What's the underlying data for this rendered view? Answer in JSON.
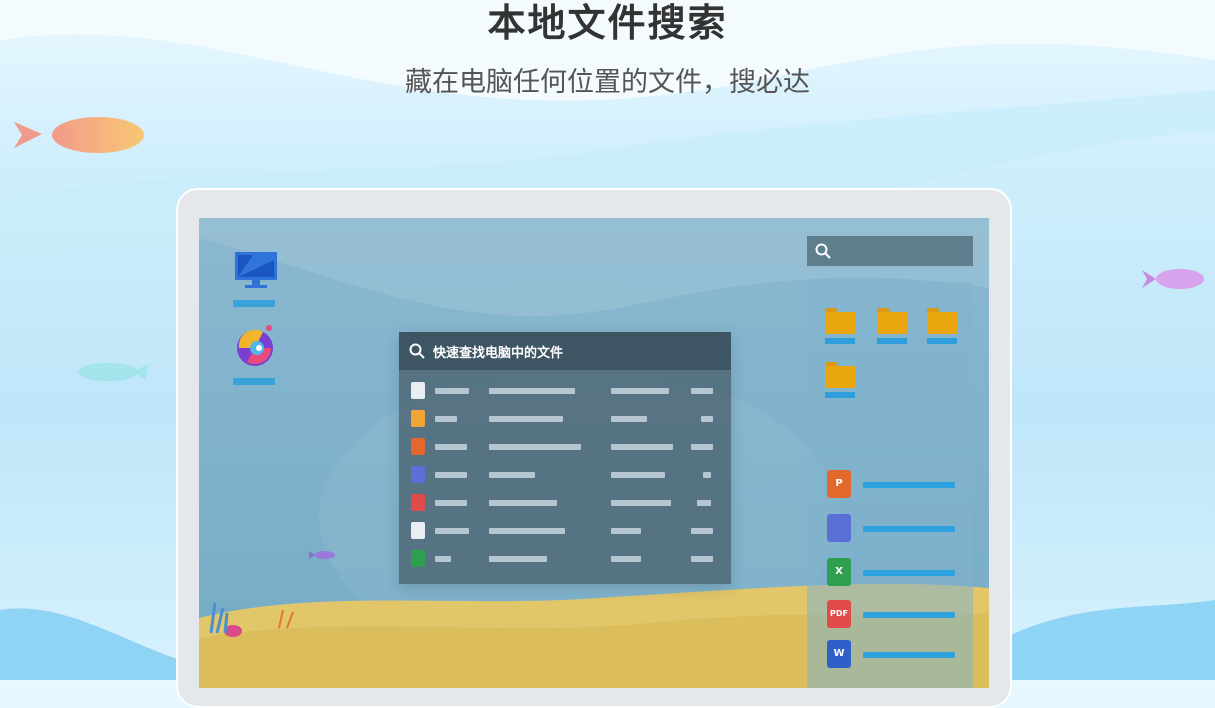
{
  "header": {
    "title": "本地文件搜索",
    "subtitle": "藏在电脑任何位置的文件，搜必达"
  },
  "search_window": {
    "title": "快速查找电脑中的文件",
    "rows": [
      {
        "icon": "document-icon",
        "color": "#e8eef2"
      },
      {
        "icon": "folder-icon",
        "color": "#f0a536"
      },
      {
        "icon": "powerpoint-icon",
        "color": "#e2692b"
      },
      {
        "icon": "image-icon",
        "color": "#5b6fd6"
      },
      {
        "icon": "pdf-icon",
        "color": "#e24b4b"
      },
      {
        "icon": "document-icon",
        "color": "#e8eef2"
      },
      {
        "icon": "excel-icon",
        "color": "#2e9e4f"
      }
    ]
  },
  "right_apps": [
    {
      "icon": "powerpoint-icon",
      "letter": "P",
      "color": "#e2692b"
    },
    {
      "icon": "image-icon",
      "letter": "",
      "color": "#5b6fd6"
    },
    {
      "icon": "excel-icon",
      "letter": "X",
      "color": "#2e9e4f"
    },
    {
      "icon": "pdf-icon",
      "letter": "PDF",
      "color": "#e24b4b"
    },
    {
      "icon": "word-icon",
      "letter": "W",
      "color": "#2f5fc9"
    }
  ],
  "colors": {
    "accent": "#2ea2de",
    "window_header": "#3e5564",
    "folder": "#e9a60f"
  }
}
